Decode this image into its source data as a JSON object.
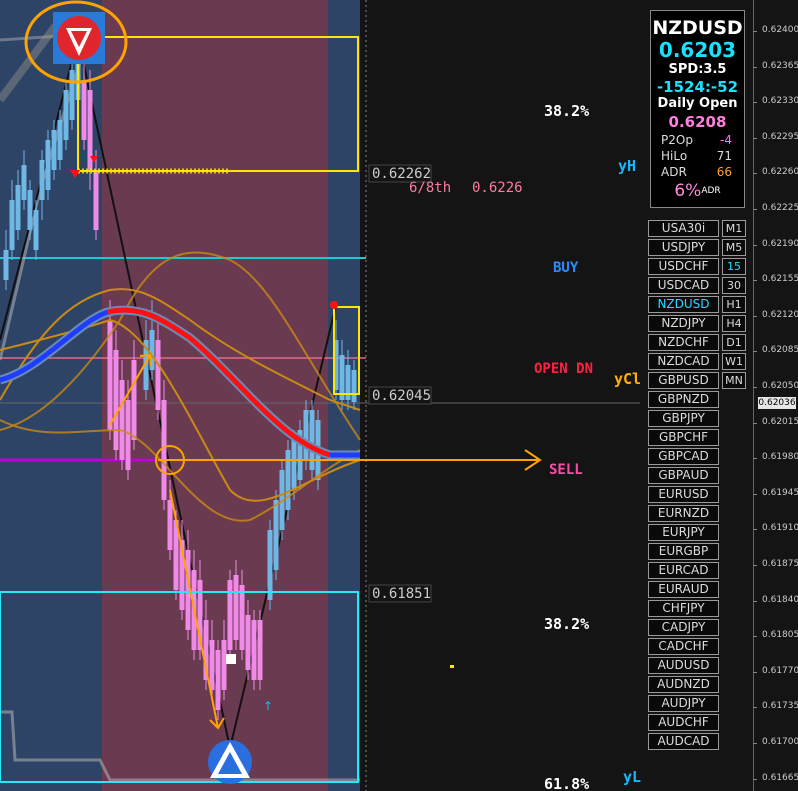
{
  "panel": {
    "symbol": "NZDUSD",
    "price": "0.6203",
    "spread": "SPD:3.5",
    "points": "-1524:-52",
    "daily_open_label": "Daily Open",
    "daily_open_value": "0.6208",
    "rows": [
      {
        "label": "P2Op",
        "value": "-4",
        "color": "#ff70ff"
      },
      {
        "label": "HiLo",
        "value": "71",
        "color": "#dddddd"
      },
      {
        "label": "ADR",
        "value": "66",
        "color": "#ff9d2f"
      }
    ],
    "adr_pct": "6%",
    "adr_sup": "ADR"
  },
  "symbols": [
    "USA30i",
    "USDJPY",
    "USDCHF",
    "USDCAD",
    "NZDUSD",
    "NZDJPY",
    "NZDCHF",
    "NZDCAD",
    "GBPUSD",
    "GBPNZD",
    "GBPJPY",
    "GBPCHF",
    "GBPCAD",
    "GBPAUD",
    "EURUSD",
    "EURNZD",
    "EURJPY",
    "EURGBP",
    "EURCAD",
    "EURAUD",
    "CHFJPY",
    "CADJPY",
    "CADCHF",
    "AUDUSD",
    "AUDNZD",
    "AUDJPY",
    "AUDCHF",
    "AUDCAD"
  ],
  "active_symbol": "NZDUSD",
  "timeframes": [
    "M1",
    "M5",
    "15",
    "30",
    "H1",
    "H4",
    "D1",
    "W1",
    "MN"
  ],
  "active_timeframe": "15",
  "axis_ticks": [
    "0.62400",
    "0.62365",
    "0.62330",
    "0.62295",
    "0.62260",
    "0.62225",
    "0.62190",
    "0.62155",
    "0.62120",
    "0.62085",
    "0.62050",
    "0.62015",
    "0.61980",
    "0.61945",
    "0.61910",
    "0.61875",
    "0.61840",
    "0.61805",
    "0.61770",
    "0.61735",
    "0.61700",
    "0.61665"
  ],
  "current_price_tag": "0.62036",
  "labels": {
    "fib_top": "38.2%",
    "fib_mid": "38.2%",
    "fib_bottom": "61.8%",
    "murrey": "6/8th",
    "murrey_value": "0.6226",
    "buy": "BUY",
    "open_dn": "OPEN DN",
    "sell": "SELL",
    "yh": "yH",
    "yc": "yCl",
    "yl": "yL",
    "box_high": "0.62262",
    "box_mid": "0.62045",
    "box_low": "0.61851"
  },
  "colors": {
    "bull_candle": "#6fb8e6",
    "bear_candle": "#f08ae8",
    "zone_blue": "#2e4466",
    "zone_red": "#6a3a50",
    "buy": "#2a8cff",
    "open_dn": "#ff2040",
    "sell": "#ff4aa8",
    "fib": "#ffffff",
    "yh": "#18b8ff",
    "yc": "#ffb000",
    "yl": "#18b8ff",
    "box_yellow": "#ffe600",
    "box_cyan": "#27e8f6"
  },
  "icons": [
    "pinbar-down-icon",
    "pinbar-up-icon"
  ]
}
